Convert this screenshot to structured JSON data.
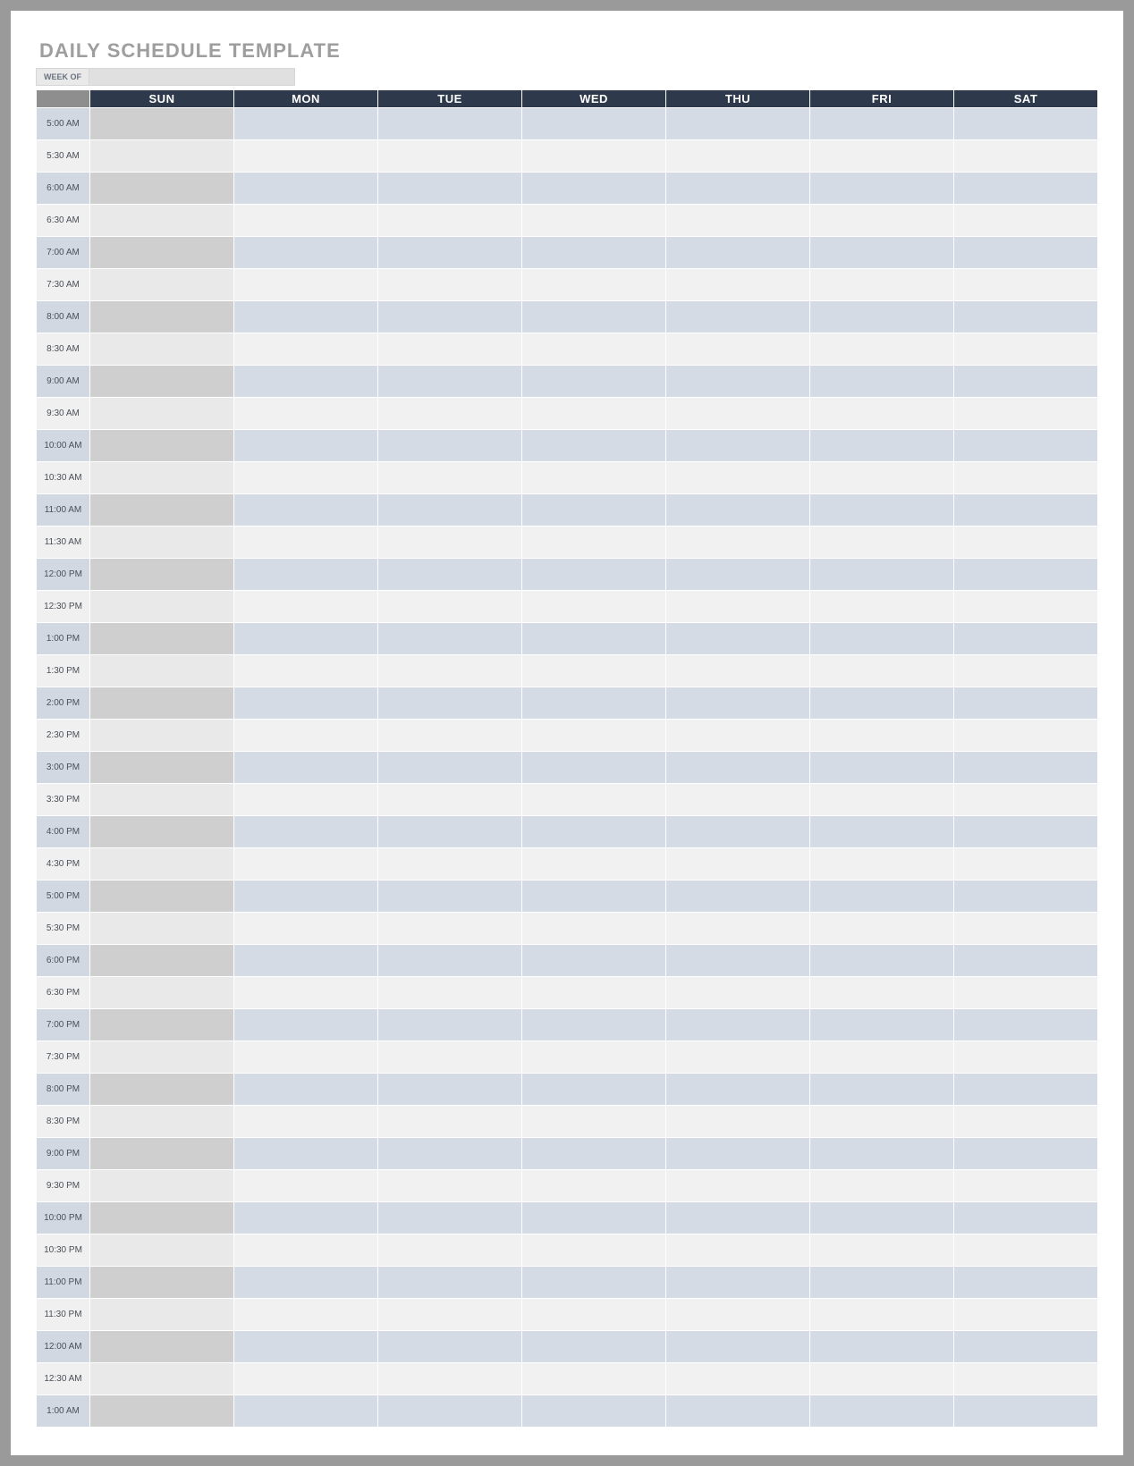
{
  "title": "DAILY SCHEDULE TEMPLATE",
  "week_of_label": "WEEK OF",
  "week_of_value": "",
  "days": [
    "SUN",
    "MON",
    "TUE",
    "WED",
    "THU",
    "FRI",
    "SAT"
  ],
  "times": [
    "5:00 AM",
    "5:30 AM",
    "6:00 AM",
    "6:30 AM",
    "7:00 AM",
    "7:30 AM",
    "8:00 AM",
    "8:30 AM",
    "9:00 AM",
    "9:30 AM",
    "10:00 AM",
    "10:30 AM",
    "11:00 AM",
    "11:30 AM",
    "12:00 PM",
    "12:30 PM",
    "1:00 PM",
    "1:30 PM",
    "2:00 PM",
    "2:30 PM",
    "3:00 PM",
    "3:30 PM",
    "4:00 PM",
    "4:30 PM",
    "5:00 PM",
    "5:30 PM",
    "6:00 PM",
    "6:30 PM",
    "7:00 PM",
    "7:30 PM",
    "8:00 PM",
    "8:30 PM",
    "9:00 PM",
    "9:30 PM",
    "10:00 PM",
    "10:30 PM",
    "11:00 PM",
    "11:30 PM",
    "12:00 AM",
    "12:30 AM",
    "1:00 AM"
  ]
}
